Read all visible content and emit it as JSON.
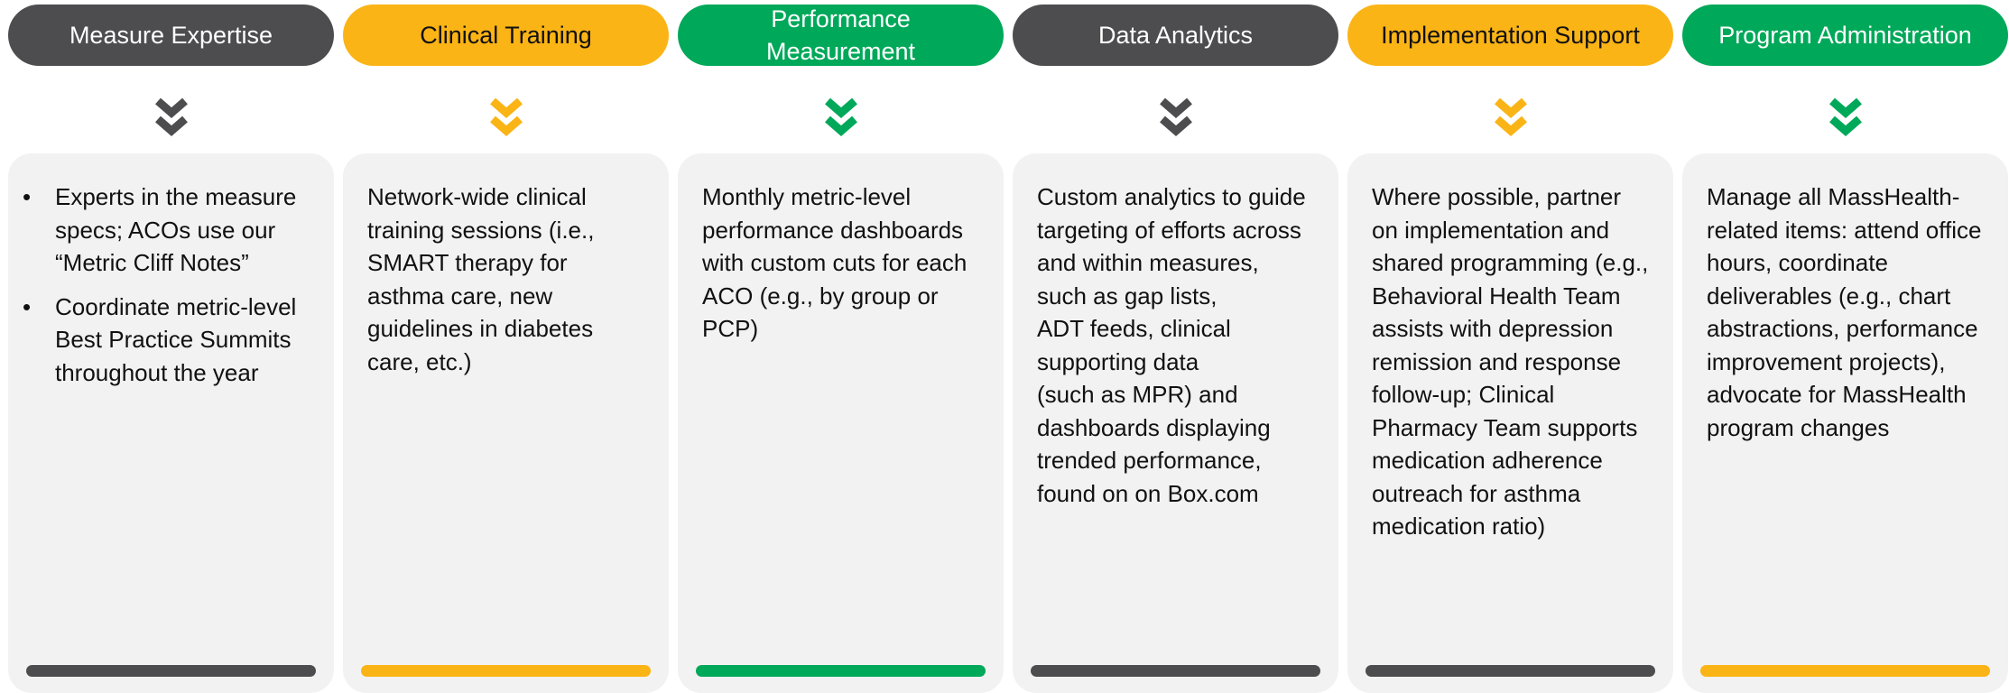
{
  "colors": {
    "gray": "#4d4d4f",
    "yellow": "#fbb416",
    "green": "#00a859",
    "card": "#f2f2f2"
  },
  "icons": {
    "chevron": "double-chevron-down-icon"
  },
  "columns": [
    {
      "title": "Measure Expertise",
      "bullets": [
        "Experts in the measure specs; ACOs use our “Metric Cliff Notes”",
        "Coordinate metric-level Best Practice Summits throughout the year"
      ]
    },
    {
      "title": "Clinical Training",
      "text": "Network-wide clinical training sessions (i.e., SMART therapy for asthma care, new guidelines in diabetes care, etc.)"
    },
    {
      "title": "Performance\nMeasurement",
      "text": "Monthly metric-level performance dashboards with custom cuts for each ACO (e.g., by group or PCP)"
    },
    {
      "title": "Data Analytics",
      "text": "Custom analytics to guide targeting of efforts across and within measures,\nsuch as gap lists,\nADT feeds, clinical supporting data\n(such as MPR) and dashboards displaying trended performance, found on on Box.com"
    },
    {
      "title": "Implementation Support",
      "text": "Where possible, partner on implementation and shared programming (e.g., Behavioral Health Team assists with depression remission and response follow-up; Clinical Pharmacy Team supports medication adherence outreach for asthma medication ratio)"
    },
    {
      "title": "Program Administration",
      "text": "Manage all MassHealth-related items: attend office hours, coordinate deliverables (e.g., chart abstractions, performance improvement projects), advocate for MassHealth program changes"
    }
  ]
}
